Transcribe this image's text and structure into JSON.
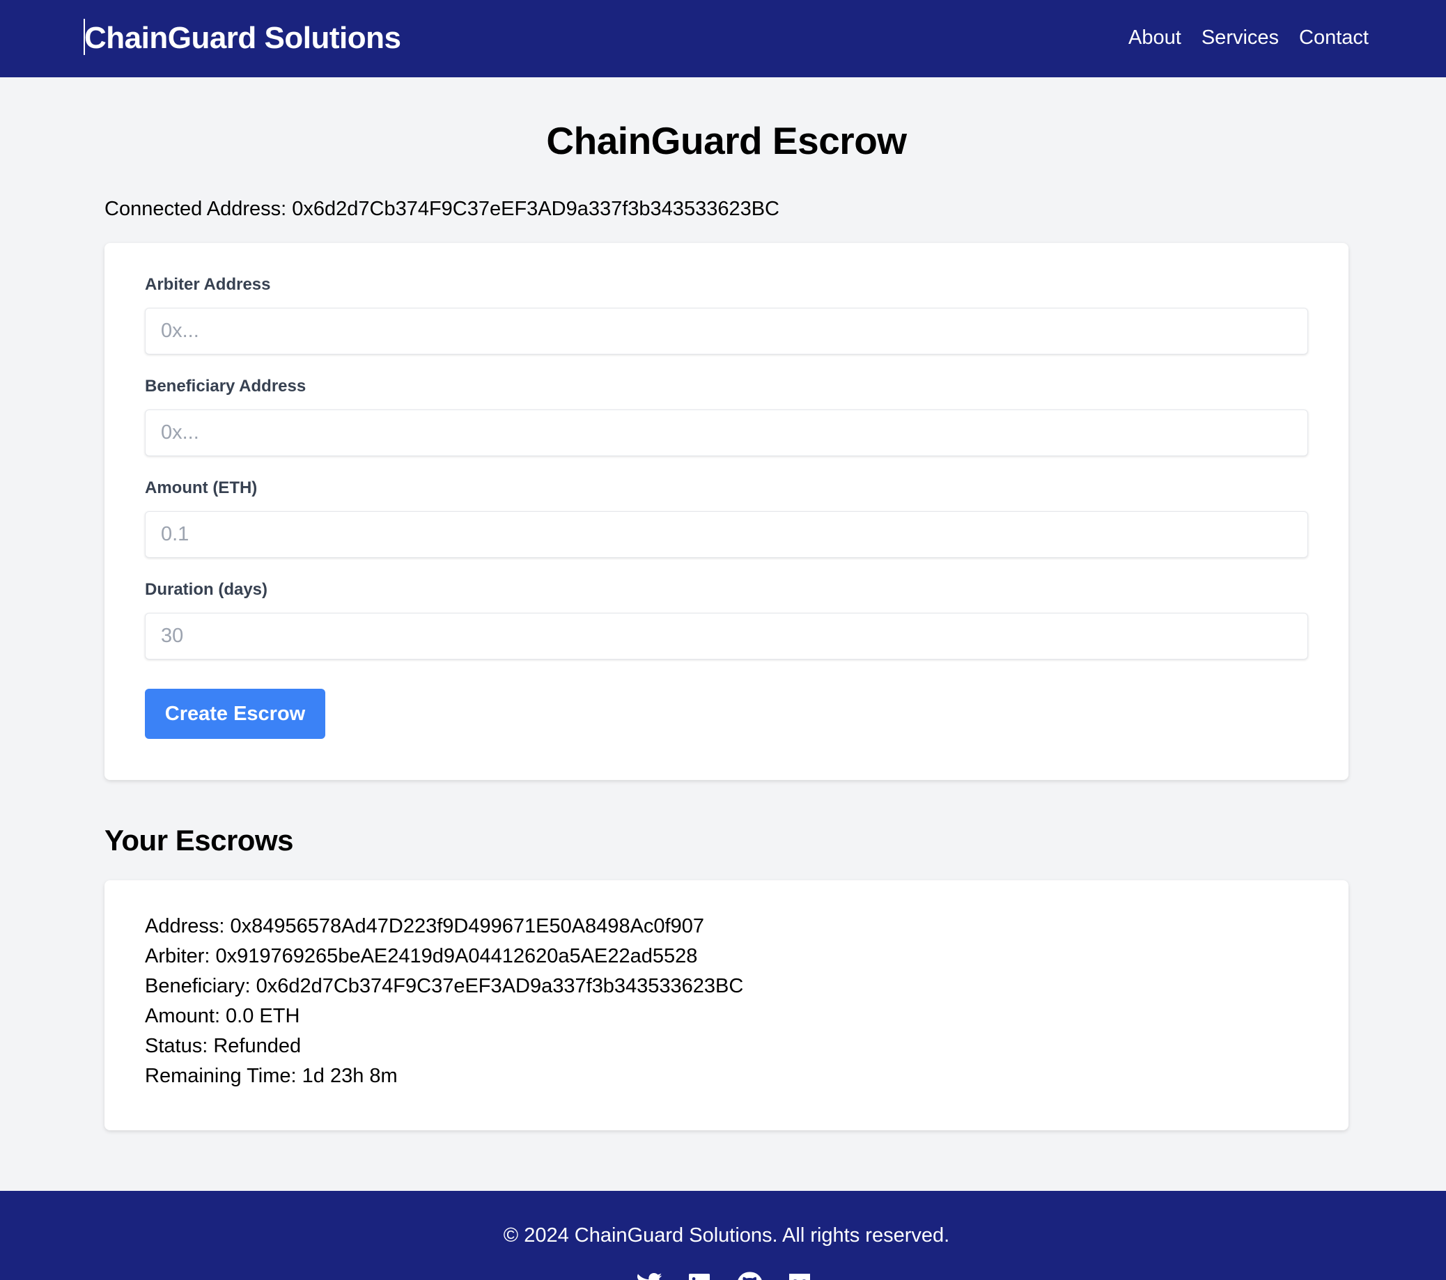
{
  "header": {
    "brand": "ChainGuard Solutions",
    "nav": [
      "About",
      "Services",
      "Contact"
    ]
  },
  "main": {
    "title": "ChainGuard Escrow",
    "connected_address": "Connected Address: 0x6d2d7Cb374F9C37eEF3AD9a337f3b343533623BC"
  },
  "form": {
    "arbiter_label": "Arbiter Address",
    "arbiter_placeholder": "0x...",
    "arbiter_value": "",
    "beneficiary_label": "Beneficiary Address",
    "beneficiary_placeholder": "0x...",
    "beneficiary_value": "",
    "amount_label": "Amount (ETH)",
    "amount_placeholder": "0.1",
    "amount_value": "",
    "duration_label": "Duration (days)",
    "duration_placeholder": "30",
    "duration_value": "",
    "submit_label": "Create Escrow"
  },
  "escrows": {
    "title": "Your Escrows",
    "items": [
      {
        "address": "Address: 0x84956578Ad47D223f9D499671E50A8498Ac0f907",
        "arbiter": "Arbiter: 0x919769265beAE2419d9A04412620a5AE22ad5528",
        "beneficiary": "Beneficiary: 0x6d2d7Cb374F9C37eEF3AD9a337f3b343533623BC",
        "amount": "Amount: 0.0 ETH",
        "status": "Status: Refunded",
        "remaining": "Remaining Time: 1d 23h 8m"
      }
    ]
  },
  "footer": {
    "copyright": "© 2024 ChainGuard Solutions. All rights reserved.",
    "socials": [
      "twitter-icon",
      "linkedin-icon",
      "github-icon",
      "medium-icon"
    ]
  },
  "colors": {
    "header_bg": "#1a237e",
    "page_bg": "#f3f4f6",
    "button_bg": "#3b82f6"
  }
}
